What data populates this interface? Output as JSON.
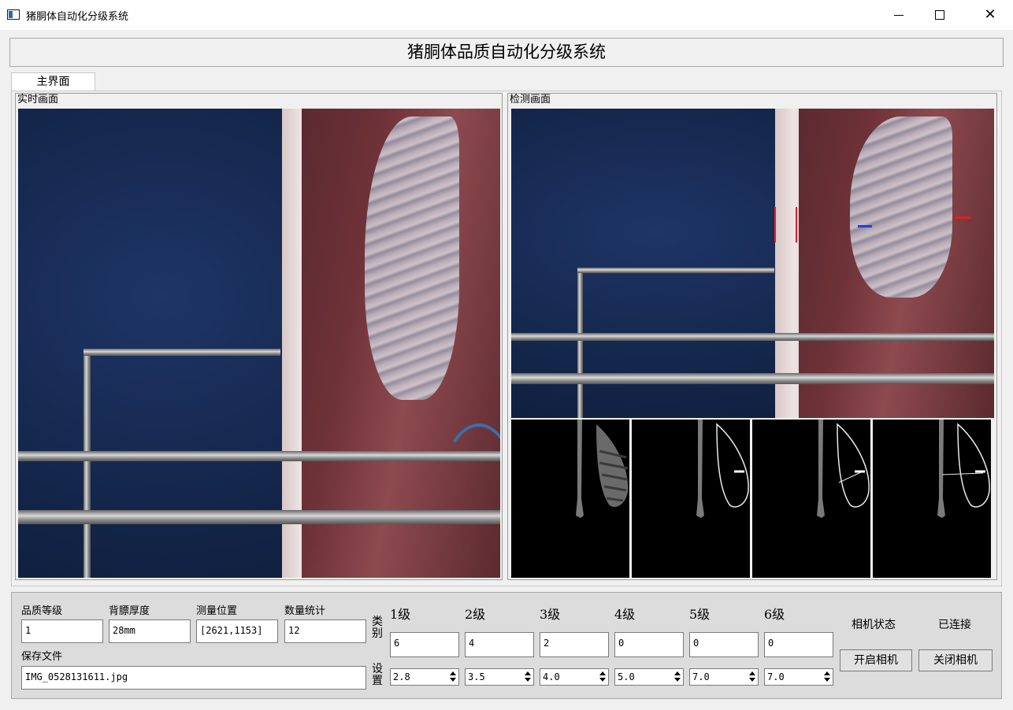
{
  "window": {
    "title": "猪胴体自动化分级系统"
  },
  "banner": {
    "title": "猪胴体品质自动化分级系统"
  },
  "tabs": [
    {
      "label": "主界面"
    }
  ],
  "panels": {
    "live_title": "实时画面",
    "detect_title": "检测画面"
  },
  "measurements": {
    "labels": {
      "grade": "品质等级",
      "thickness": "背膘厚度",
      "position": "测量位置",
      "count": "数量统计",
      "save_file": "保存文件"
    },
    "values": {
      "grade": "1",
      "thickness": "28mm",
      "position": "[2621,1153]",
      "count": "12",
      "save_file": "IMG_0528131611.jpg"
    }
  },
  "side_labels": {
    "category": [
      "类",
      "别"
    ],
    "setting": [
      "设",
      "置"
    ]
  },
  "grades": [
    {
      "label": "1级",
      "count": "6",
      "threshold": "2.8"
    },
    {
      "label": "2级",
      "count": "4",
      "threshold": "3.5"
    },
    {
      "label": "3级",
      "count": "2",
      "threshold": "4.0"
    },
    {
      "label": "4级",
      "count": "0",
      "threshold": "5.0"
    },
    {
      "label": "5级",
      "count": "0",
      "threshold": "7.0"
    },
    {
      "label": "6级",
      "count": "0",
      "threshold": "7.0"
    }
  ],
  "camera": {
    "status_label": "相机状态",
    "status_value": "已连接",
    "open_button": "开启相机",
    "close_button": "关闭相机"
  },
  "colors": {
    "marker_red": "#e02020",
    "marker_blue": "#2040e0"
  }
}
